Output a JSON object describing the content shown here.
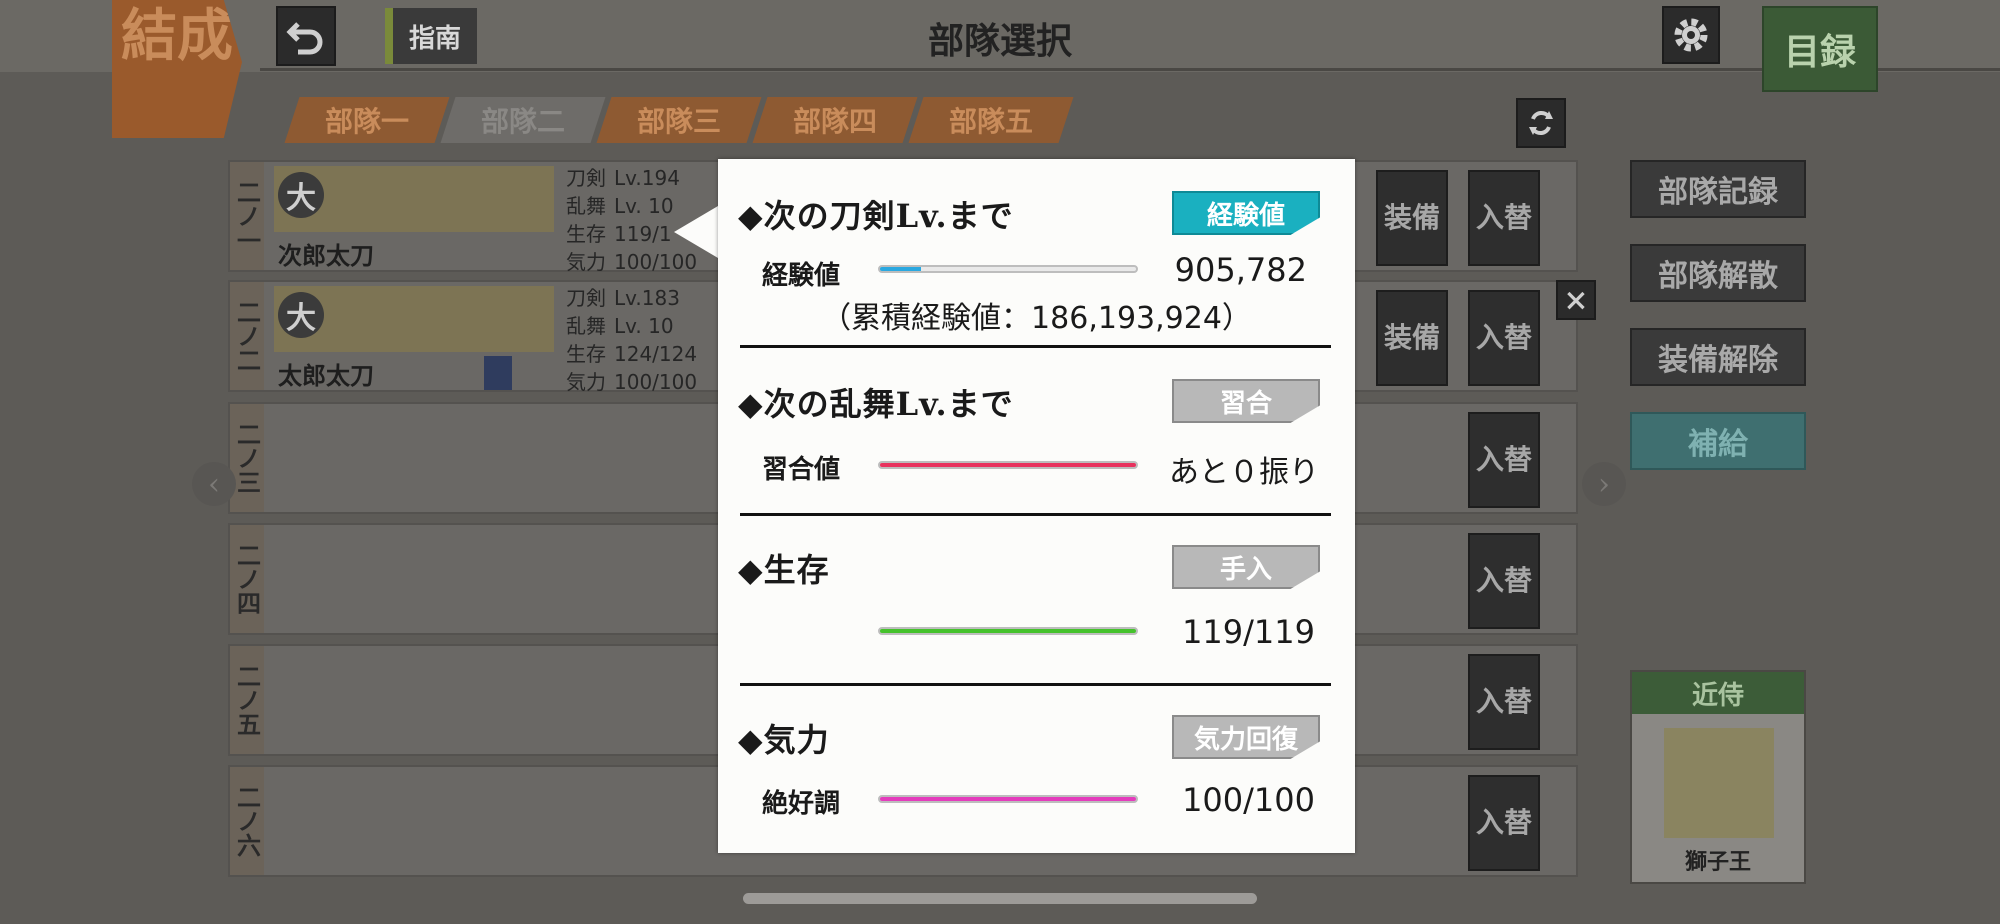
{
  "header": {
    "mode_label": "結成",
    "guide_label": "指南",
    "title": "部隊選択",
    "catalog_label": "目録"
  },
  "tabs": [
    {
      "label": "部隊一"
    },
    {
      "label": "部隊二"
    },
    {
      "label": "部隊三"
    },
    {
      "label": "部隊四"
    },
    {
      "label": "部隊五"
    }
  ],
  "slots": [
    {
      "label": "二ノ一",
      "name": "次郎太刀",
      "stat_labels": [
        "刀剣",
        "乱舞",
        "生存",
        "気力"
      ],
      "stat_values": [
        "Lv.194",
        "Lv. 10",
        "119/1",
        "100/100"
      ],
      "equip": "装備",
      "swap": "入替"
    },
    {
      "label": "二ノ二",
      "name": "太郎太刀",
      "stat_labels": [
        "刀剣",
        "乱舞",
        "生存",
        "気力"
      ],
      "stat_values": [
        "Lv.183",
        "Lv. 10",
        "124/124",
        "100/100"
      ],
      "equip": "装備",
      "swap": "入替"
    },
    {
      "label": "二ノ三",
      "swap": "入替"
    },
    {
      "label": "二ノ四",
      "swap": "入替"
    },
    {
      "label": "二ノ五",
      "swap": "入替"
    },
    {
      "label": "二ノ六",
      "swap": "入替"
    }
  ],
  "badge_type": "大",
  "right_buttons": [
    "部隊記録",
    "部隊解散",
    "装備解除",
    "補給"
  ],
  "attendant": {
    "title": "近侍",
    "name": "獅子王"
  },
  "popup": {
    "sec1": {
      "title": "◆次の刀剣Lv.まで",
      "button": "経験値",
      "label": "経験値",
      "value": "905,782",
      "total": "（累積経験値：186,193,924）",
      "progress": 0.16,
      "color": "#2aa8e0"
    },
    "sec2": {
      "title": "◆次の乱舞Lv.まで",
      "button": "習合",
      "label": "習合値",
      "value": "あと０振り",
      "progress": 1.0,
      "color": "#e8325e"
    },
    "sec3": {
      "title": "◆生存",
      "button": "手入",
      "label": "",
      "value": "119/119",
      "progress": 1.0,
      "color": "#45c22c"
    },
    "sec4": {
      "title": "◆気力",
      "button": "気力回復",
      "label": "絶好調",
      "value": "100/100",
      "progress": 1.0,
      "color": "#e43cbc"
    }
  }
}
